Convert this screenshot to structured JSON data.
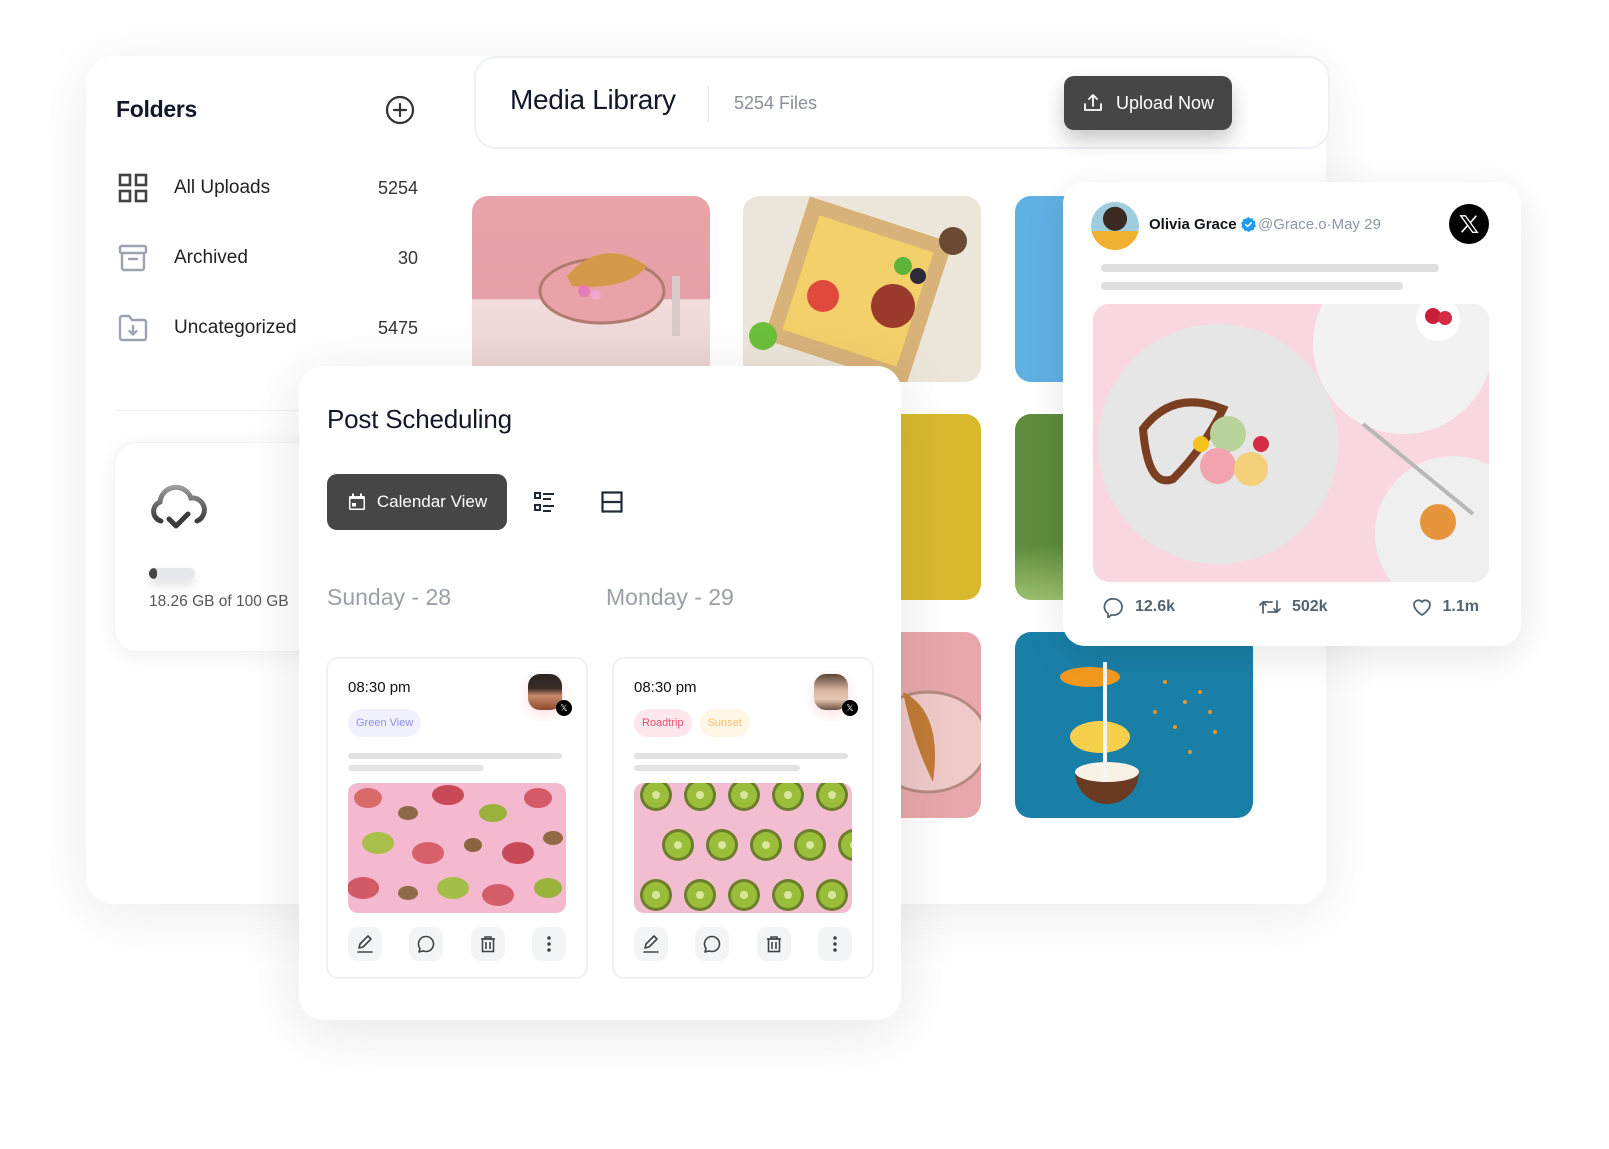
{
  "folders": {
    "title": "Folders",
    "items": [
      {
        "label": "All Uploads",
        "count": "5254",
        "icon": "grid-icon"
      },
      {
        "label": "Archived",
        "count": "30",
        "icon": "archive-icon"
      },
      {
        "label": "Uncategorized",
        "count": "5475",
        "icon": "folder-download-icon"
      }
    ],
    "storage": {
      "used_text": "18.26 GB of 100 GB",
      "used_fraction": 0.1826
    }
  },
  "media_library": {
    "title": "Media Library",
    "file_count": "5254 Files",
    "upload_label": "Upload Now",
    "tiles": [
      {
        "subject": "croissant on pink plate",
        "bg": "#e8a7ad"
      },
      {
        "subject": "fruit and charcuterie box",
        "bg": "#d9c7a5"
      },
      {
        "subject": "blue background",
        "bg": "#5fb1e3"
      },
      {
        "subject": "yellow background",
        "bg": "#d8b92e"
      },
      {
        "subject": "green background",
        "bg": "#5e8c3c"
      },
      {
        "subject": "croissant on pink background",
        "bg": "#e3a4a8"
      },
      {
        "subject": "floating fruit on blue",
        "bg": "#1a7fa7"
      }
    ]
  },
  "scheduling": {
    "title": "Post Scheduling",
    "calendar_view_label": "Calendar View",
    "days": [
      {
        "label": "Sunday - 28",
        "post": {
          "time": "08:30 pm",
          "tags": [
            {
              "label": "Green View",
              "bg": "#f1f1fd",
              "color": "#8b8ee6"
            }
          ],
          "image": "figs on pink"
        }
      },
      {
        "label": "Monday - 29",
        "post": {
          "time": "08:30 pm",
          "tags": [
            {
              "label": "Roadtrip",
              "bg": "#fde7ec",
              "color": "#e8506f"
            },
            {
              "label": "Sunset",
              "bg": "#fff6e6",
              "color": "#f1c16a"
            }
          ],
          "image": "kiwi slices on pink"
        }
      }
    ]
  },
  "tweet": {
    "name": "Olivia Grace",
    "handle": "@Grace.o",
    "separator": "·",
    "date": "May 29",
    "stats": {
      "replies": "12.6k",
      "retweets": "502k",
      "likes": "1.1m"
    }
  },
  "colors": {
    "dark_button": "#464646",
    "verified": "#1d9bf0"
  }
}
